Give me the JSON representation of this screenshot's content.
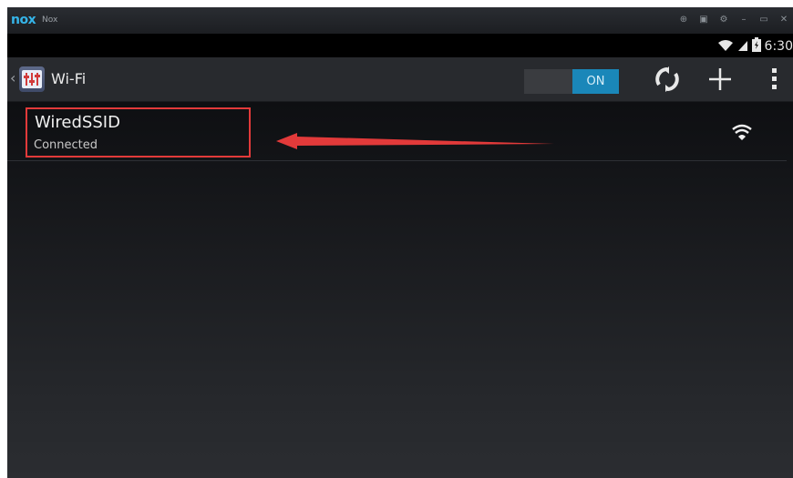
{
  "window": {
    "logo": "nox",
    "title": "Nox",
    "controls": [
      "settings-pin-icon",
      "screenshot-icon",
      "gear-icon",
      "minimize-icon",
      "maximize-icon",
      "close-icon"
    ],
    "control_glyphs": [
      "⊕",
      "▣",
      "⚙",
      "–",
      "▭",
      "✕"
    ]
  },
  "status_bar": {
    "time": "6:30",
    "icons": [
      "wifi-signal-icon",
      "cell-signal-icon",
      "battery-icon"
    ]
  },
  "action_bar": {
    "back": "‹",
    "title": "Wi-Fi",
    "toggle_label": "ON",
    "toggle_state": "on",
    "actions": [
      "wps-icon",
      "add-network-icon",
      "overflow-menu-icon"
    ]
  },
  "networks": [
    {
      "ssid": "WiredSSID",
      "status": "Connected",
      "highlighted": true
    }
  ],
  "colors": {
    "accent": "#1a87b9",
    "annotation": "#e23a3a"
  }
}
